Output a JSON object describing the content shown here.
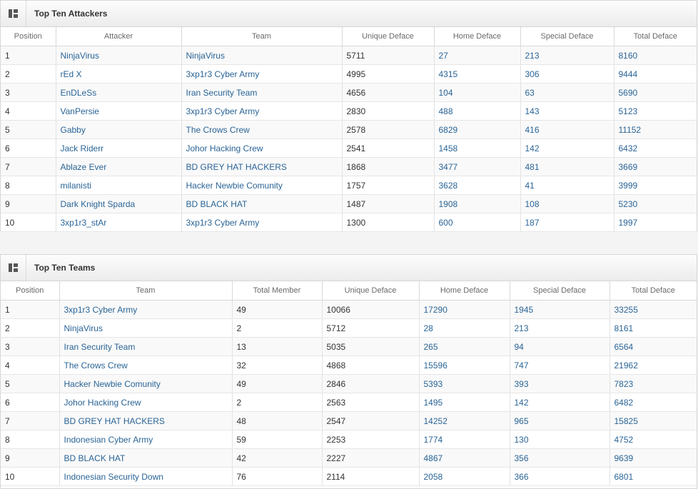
{
  "attackers": {
    "title": "Top Ten Attackers",
    "columns": [
      "Position",
      "Attacker",
      "Team",
      "Unique Deface",
      "Home Deface",
      "Special Deface",
      "Total Deface"
    ],
    "rows": [
      [
        "1",
        "NinjaVirus",
        "NinjaVirus",
        "5711",
        "27",
        "213",
        "8160"
      ],
      [
        "2",
        "rEd X",
        "3xp1r3 Cyber Army",
        "4995",
        "4315",
        "306",
        "9444"
      ],
      [
        "3",
        "EnDLeSs",
        "Iran Security Team",
        "4656",
        "104",
        "63",
        "5690"
      ],
      [
        "4",
        "VanPersie",
        "3xp1r3 Cyber Army",
        "2830",
        "488",
        "143",
        "5123"
      ],
      [
        "5",
        "Gabby",
        "The Crows Crew",
        "2578",
        "6829",
        "416",
        "11152"
      ],
      [
        "6",
        "Jack Riderr",
        "Johor Hacking Crew",
        "2541",
        "1458",
        "142",
        "6432"
      ],
      [
        "7",
        "Ablaze Ever",
        "BD GREY HAT HACKERS",
        "1868",
        "3477",
        "481",
        "3669"
      ],
      [
        "8",
        "milanisti",
        "Hacker Newbie Comunity",
        "1757",
        "3628",
        "41",
        "3999"
      ],
      [
        "9",
        "Dark Knight Sparda",
        "BD BLACK HAT",
        "1487",
        "1908",
        "108",
        "5230"
      ],
      [
        "10",
        "3xp1r3_stAr",
        "3xp1r3 Cyber Army",
        "1300",
        "600",
        "187",
        "1997"
      ]
    ]
  },
  "teams": {
    "title": "Top Ten Teams",
    "columns": [
      "Position",
      "Team",
      "Total Member",
      "Unique Deface",
      "Home Deface",
      "Special Deface",
      "Total Deface"
    ],
    "rows": [
      [
        "1",
        "3xp1r3 Cyber Army",
        "49",
        "10066",
        "17290",
        "1945",
        "33255"
      ],
      [
        "2",
        "NinjaVirus",
        "2",
        "5712",
        "28",
        "213",
        "8161"
      ],
      [
        "3",
        "Iran Security Team",
        "13",
        "5035",
        "265",
        "94",
        "6564"
      ],
      [
        "4",
        "The Crows Crew",
        "32",
        "4868",
        "15596",
        "747",
        "21962"
      ],
      [
        "5",
        "Hacker Newbie Comunity",
        "49",
        "2846",
        "5393",
        "393",
        "7823"
      ],
      [
        "6",
        "Johor Hacking Crew",
        "2",
        "2563",
        "1495",
        "142",
        "6482"
      ],
      [
        "7",
        "BD GREY HAT HACKERS",
        "48",
        "2547",
        "14252",
        "965",
        "15825"
      ],
      [
        "8",
        "Indonesian Cyber Army",
        "59",
        "2253",
        "1774",
        "130",
        "4752"
      ],
      [
        "9",
        "BD BLACK HAT",
        "42",
        "2227",
        "4867",
        "356",
        "9639"
      ],
      [
        "10",
        "Indonesian Security Down",
        "76",
        "2114",
        "2058",
        "366",
        "6801"
      ]
    ]
  },
  "icons": {
    "header_icon": "grid-widget-icon"
  },
  "colors": {
    "link": "#2a6496",
    "text": "#333333",
    "header_text": "#6a6a6a"
  }
}
